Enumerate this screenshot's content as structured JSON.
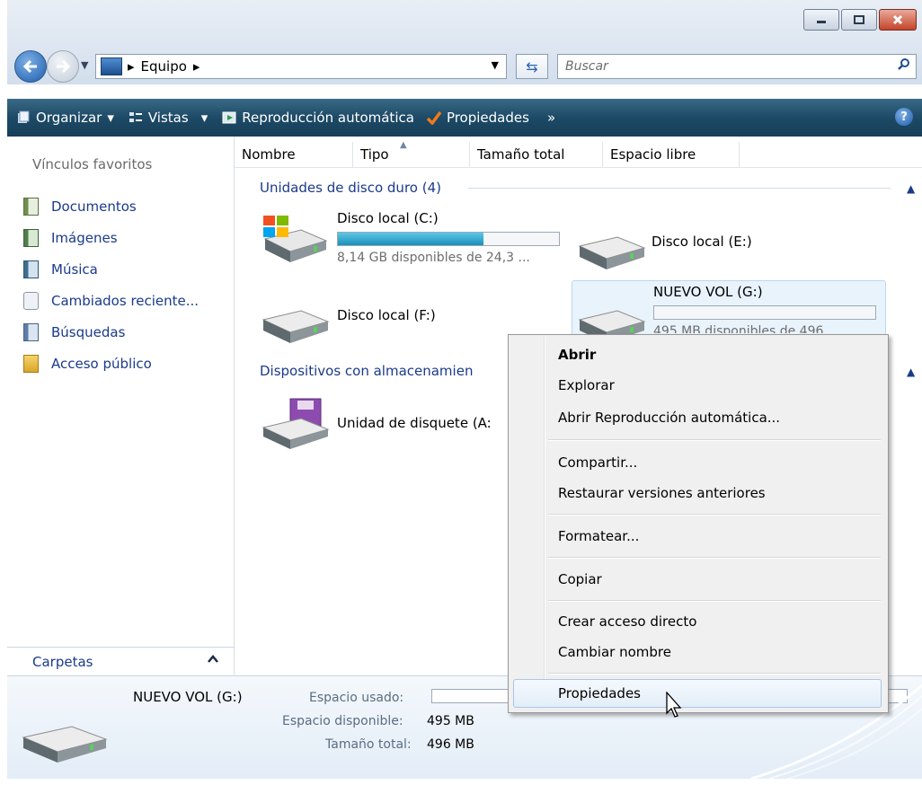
{
  "window": {
    "minimize_icon": "minimize-icon",
    "maximize_icon": "maximize-icon",
    "close_icon": "close-icon"
  },
  "address": {
    "crumbs": [
      "Equipo"
    ],
    "search_placeholder": "Buscar"
  },
  "toolbar": {
    "organize": "Organizar",
    "views": "Vistas",
    "autoplay": "Reproducción automática",
    "properties": "Propiedades",
    "more": "»",
    "help": "?"
  },
  "nav": {
    "title": "Vínculos favoritos",
    "favorites": [
      {
        "label": "Documentos",
        "icon": "documents-icon"
      },
      {
        "label": "Imágenes",
        "icon": "pictures-icon"
      },
      {
        "label": "Música",
        "icon": "music-icon"
      },
      {
        "label": "Cambiados reciente...",
        "icon": "recent-icon"
      },
      {
        "label": "Búsquedas",
        "icon": "searches-icon"
      },
      {
        "label": "Acceso público",
        "icon": "public-folder-icon"
      }
    ],
    "folders_label": "Carpetas"
  },
  "columns": [
    "Nombre",
    "Tipo",
    "Tamaño total",
    "Espacio libre"
  ],
  "groups": {
    "hard_drives": "Unidades de disco duro (4)",
    "removable": "Dispositivos con almacenamien"
  },
  "drives": {
    "c": {
      "name": "Disco local (C:)",
      "detail": "8,14 GB disponibles de 24,3 ...",
      "used_fraction": 0.66
    },
    "e": {
      "name": "Disco local (E:)"
    },
    "f": {
      "name": "Disco local (F:)"
    },
    "g": {
      "name": "NUEVO VOL (G:)",
      "detail": "495 MB disponibles de 496 ...",
      "used_fraction": 0.0
    },
    "floppy": {
      "name": "Unidad de disquete (A:"
    }
  },
  "details": {
    "name": "NUEVO VOL (G:)",
    "used_label": "Espacio usado:",
    "free_label": "Espacio disponible:",
    "free_value": "495 MB",
    "total_label": "Tamaño total:",
    "total_value": "496 MB"
  },
  "context_menu": {
    "open": "Abrir",
    "explore": "Explorar",
    "open_autoplay": "Abrir Reproducción automática...",
    "share": "Compartir...",
    "restore": "Restaurar versiones anteriores",
    "format": "Formatear...",
    "copy": "Copiar",
    "create_shortcut": "Crear acceso directo",
    "rename": "Cambiar nombre",
    "properties": "Propiedades"
  }
}
